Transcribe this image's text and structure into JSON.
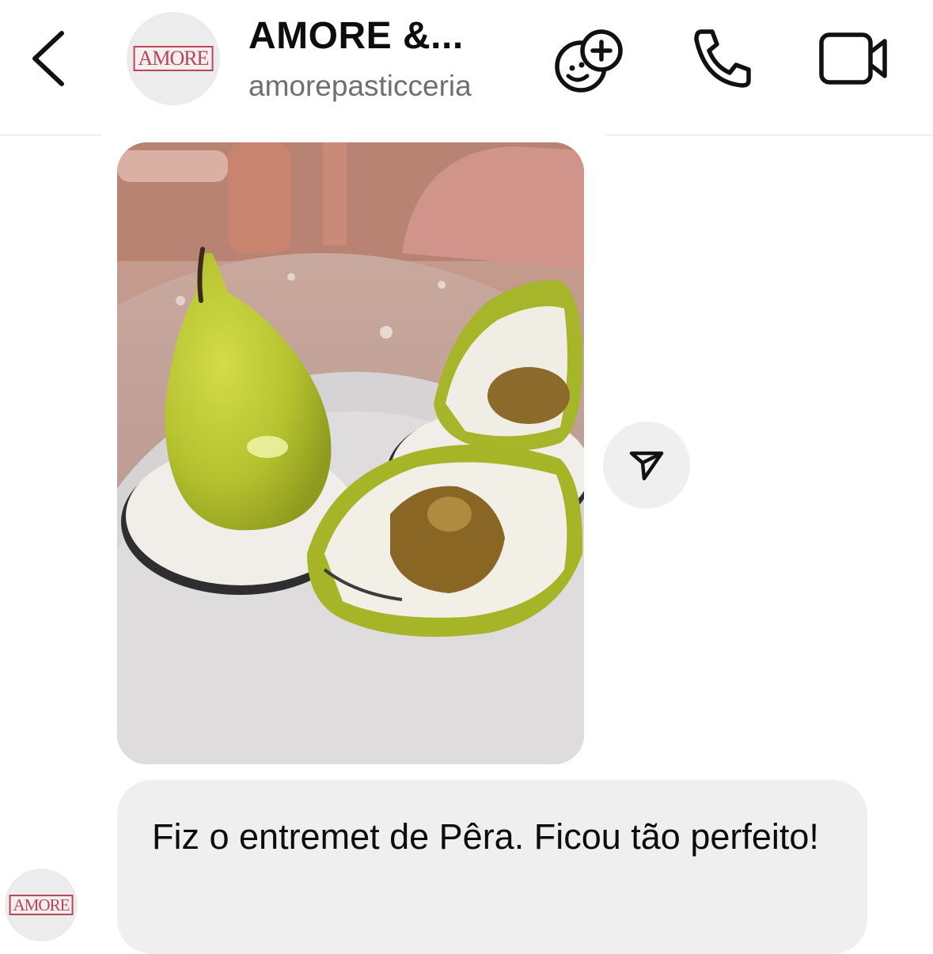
{
  "header": {
    "contact_name": "AMORE &...",
    "username": "amorepasticceria",
    "avatar_logo_text": "AMORE",
    "icons": {
      "back": "chevron-left-icon",
      "effects": "face-plus-icon",
      "call": "phone-icon",
      "video": "video-camera-icon"
    }
  },
  "messages": [
    {
      "type": "photo",
      "description": "Pear-shaped green entremet next to a cut-open one showing cream and pear filling",
      "share_icon": "send-share-icon"
    },
    {
      "type": "text",
      "text": "Fiz o entremet de Pêra. Ficou tão perfeito!",
      "sender_avatar_logo_text": "AMORE"
    }
  ],
  "colors": {
    "bubble_bg": "#efefef",
    "secondary_text": "#6f6f6f",
    "logo_accent": "#b9455a",
    "pear_green": "#b5c22f"
  }
}
